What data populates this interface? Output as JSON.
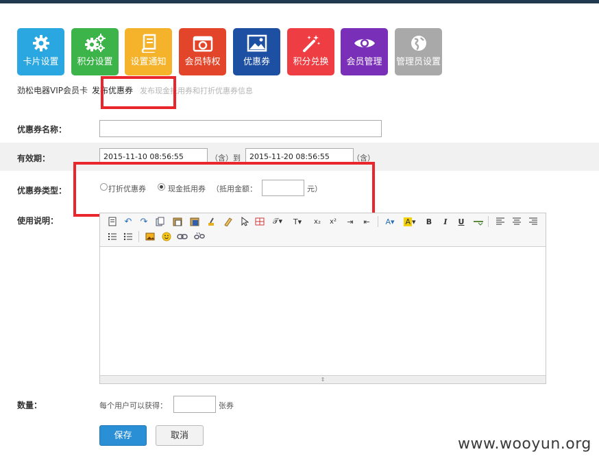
{
  "tiles": [
    {
      "label": "卡片设置",
      "color": "#2aa7e0",
      "icon": "gear-icon"
    },
    {
      "label": "积分设置",
      "color": "#3cb44a",
      "icon": "gears-icon"
    },
    {
      "label": "设置通知",
      "color": "#f5b32c",
      "icon": "book-icon"
    },
    {
      "label": "会员特权",
      "color": "#e2452a",
      "icon": "camera-icon"
    },
    {
      "label": "优惠券",
      "color": "#1d4fa3",
      "icon": "picture-icon"
    },
    {
      "label": "积分兑换",
      "color": "#ee3e44",
      "icon": "magic-wand-icon"
    },
    {
      "label": "会员管理",
      "color": "#7a2fb8",
      "icon": "eye-icon"
    },
    {
      "label": "管理员设置",
      "color": "#a9a9a9",
      "icon": "globe-icon"
    }
  ],
  "breadcrumb": {
    "store": "劲松电器VIP会员卡",
    "active": "发布优惠券",
    "description": "发布现金抵用券和打折优惠券信息"
  },
  "form": {
    "name_label": "优惠券名称：",
    "name_value": "",
    "validity_label": "有效期：",
    "start_date": "2015-11-10 08:56:55",
    "incl1": "（含）到",
    "end_date": "2015-11-20 08:56:55",
    "incl2": "（含）",
    "type_label": "优惠券类型：",
    "type_options": [
      "打折优惠券",
      "现金抵用券"
    ],
    "type_selected": "现金抵用券",
    "amount_prefix": "（抵用金额：",
    "amount_value": "",
    "amount_suffix": "元）",
    "desc_label": "使用说明：",
    "qty_label": "数量：",
    "qty_prefix": "每个用户可以获得：",
    "qty_value": "",
    "qty_suffix": "张券"
  },
  "editor_toolbar": {
    "row1": [
      "source-icon",
      "undo-icon",
      "redo-icon",
      "copy-icon",
      "paste-icon",
      "paste-word-icon",
      "format-brush-icon",
      "clear-format-icon",
      "select-icon",
      "table-icon",
      "font-family-icon",
      "font-size-icon",
      "subscript-icon",
      "superscript-icon",
      "indent-icon",
      "outdent-icon",
      "font-color-icon",
      "highlight-icon",
      "bold-icon",
      "italic-icon",
      "underline-icon",
      "horizontal-rule-icon",
      "align-left-icon",
      "align-center-icon",
      "align-right-icon"
    ],
    "row2": [
      "ordered-list-icon",
      "unordered-list-icon",
      "image-icon",
      "emoticon-icon",
      "link-icon",
      "unlink-icon"
    ],
    "font_color_glyph": "A",
    "bold_glyph": "B",
    "italic_glyph": "I",
    "underline_glyph": "U"
  },
  "buttons": {
    "save": "保存",
    "cancel": "取消"
  },
  "watermark": "www.wooyun.org"
}
